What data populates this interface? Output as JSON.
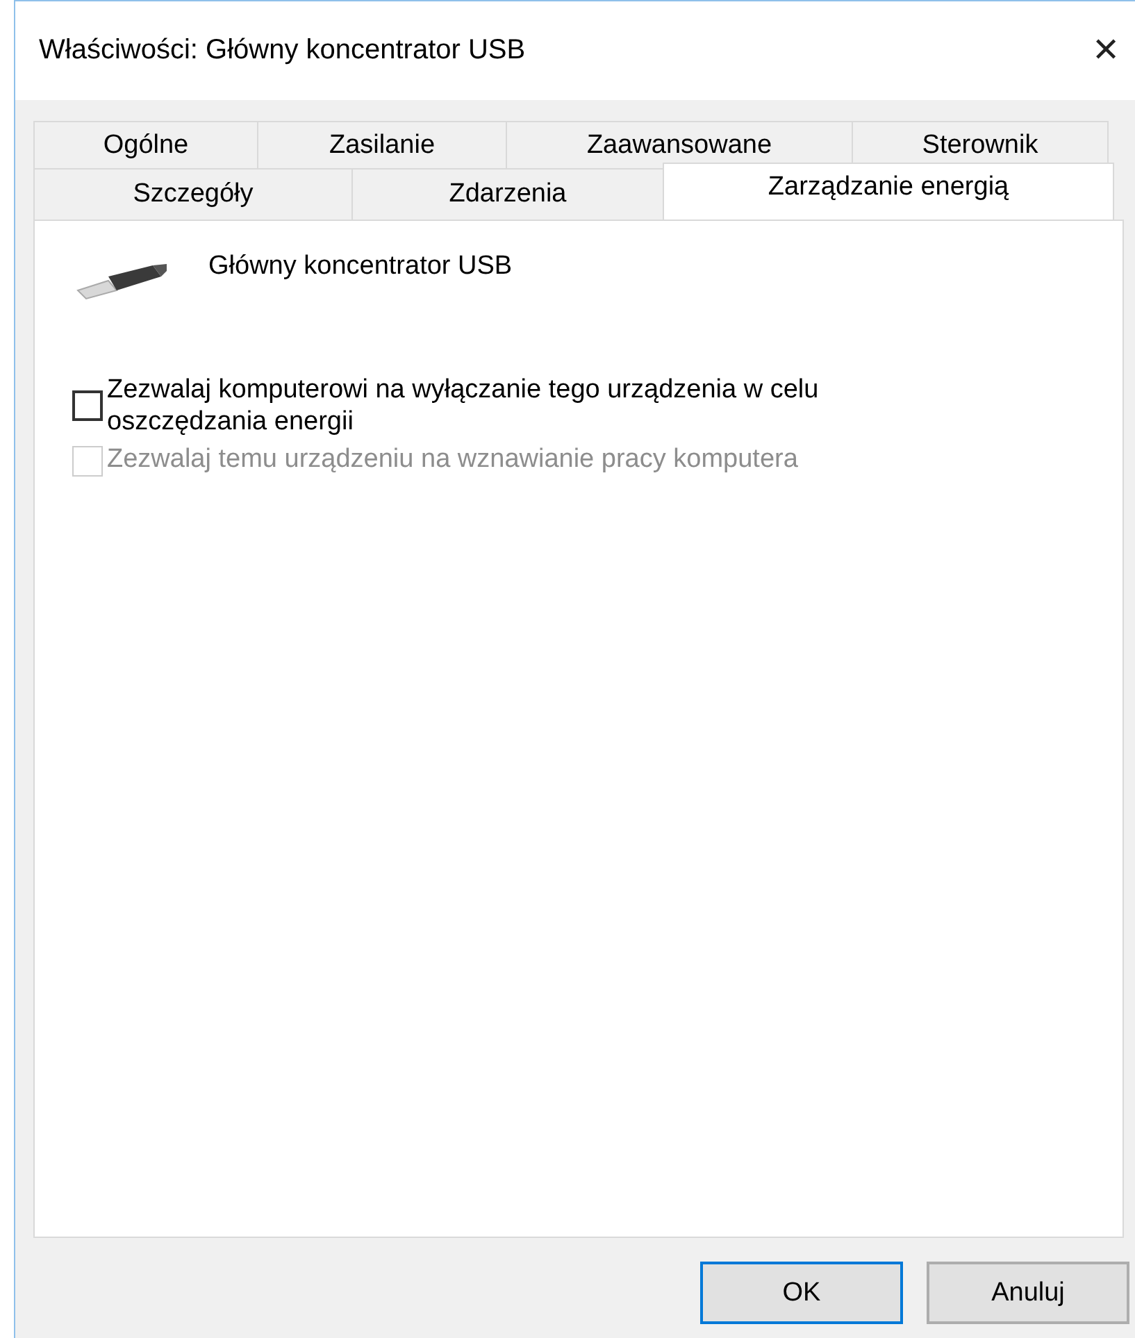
{
  "window": {
    "title": "Właściwości: Główny koncentrator USB",
    "close": "✕"
  },
  "tab_rows": [
    [
      {
        "label": "Ogólne",
        "selected": false
      },
      {
        "label": "Zasilanie",
        "selected": false
      },
      {
        "label": "Zaawansowane",
        "selected": false
      },
      {
        "label": "Sterownik",
        "selected": false
      }
    ],
    [
      {
        "label": "Szczegóły",
        "selected": false
      },
      {
        "label": "Zdarzenia",
        "selected": false
      },
      {
        "label": "Zarządzanie energią",
        "selected": true
      }
    ]
  ],
  "device": {
    "name": "Główny koncentrator USB"
  },
  "options": [
    {
      "label": "Zezwalaj komputerowi na wyłączanie tego urządzenia w celu oszczędzania energii",
      "checked": false,
      "disabled": false
    },
    {
      "label": "Zezwalaj temu urządzeniu na wznawianie pracy komputera",
      "checked": false,
      "disabled": true
    }
  ],
  "buttons": [
    {
      "label": "OK",
      "default": true
    },
    {
      "label": "Anuluj",
      "default": false
    }
  ]
}
